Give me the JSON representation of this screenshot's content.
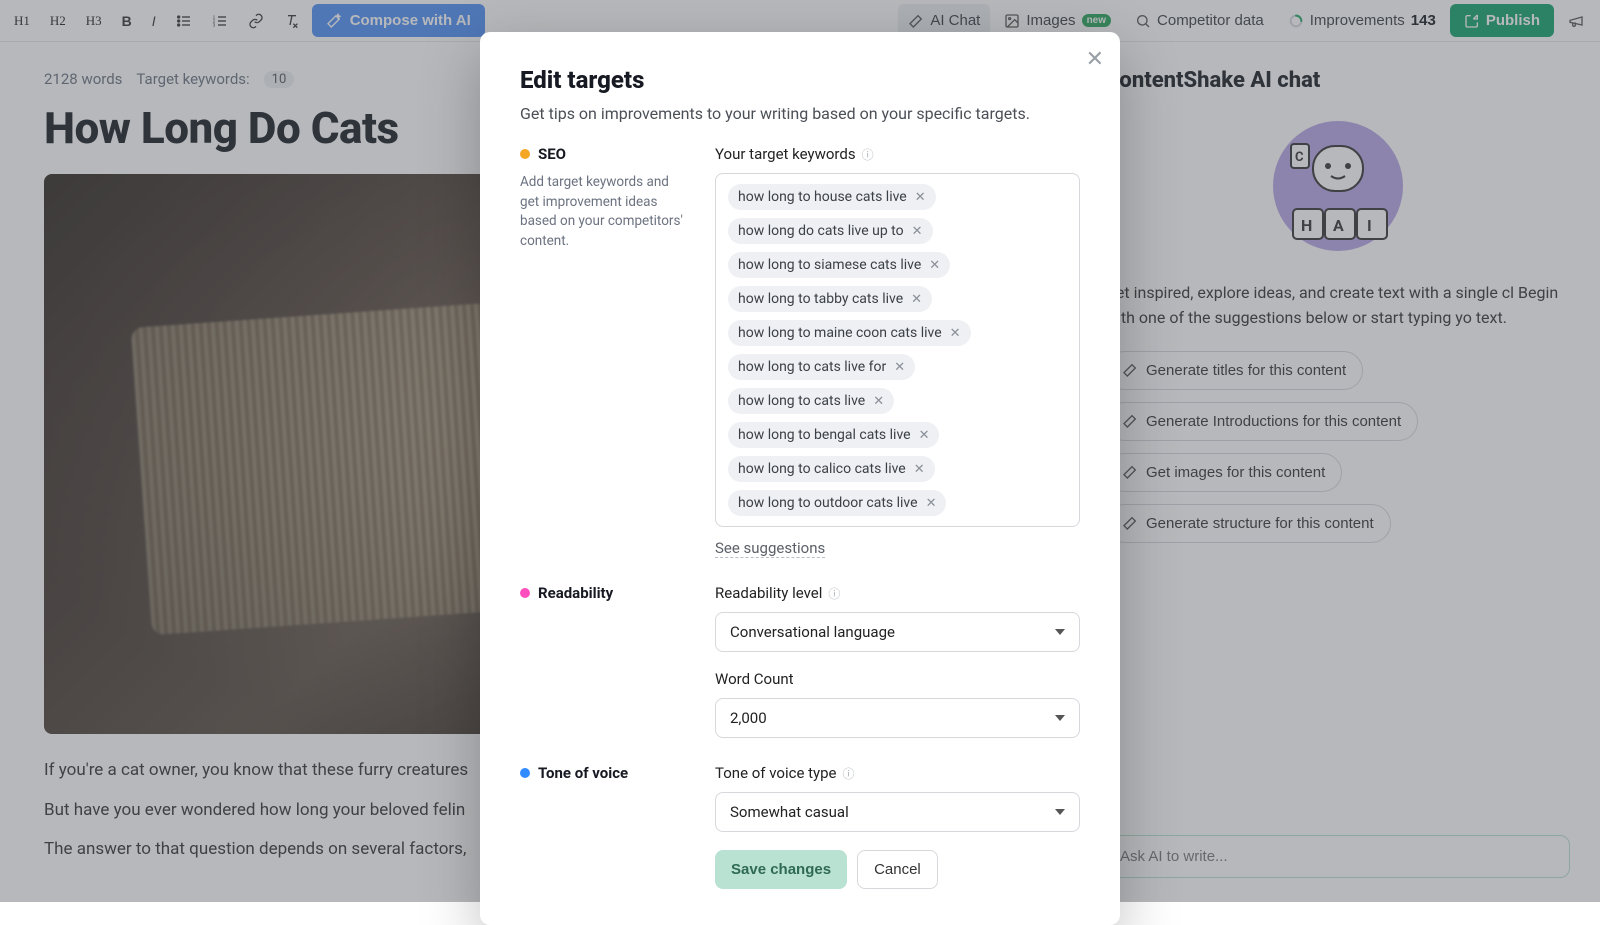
{
  "toolbar": {
    "h1": "H1",
    "h2": "H2",
    "h3": "H3",
    "bold": "B",
    "italic": "I",
    "compose": "Compose with AI",
    "ai_chat": "AI Chat",
    "images": "Images",
    "images_badge": "new",
    "competitor": "Competitor data",
    "improvements": "Improvements",
    "improvements_count": "143",
    "publish": "Publish"
  },
  "meta": {
    "words": "2128 words",
    "target_keywords_label": "Target keywords:",
    "keyword_count": "10"
  },
  "doc": {
    "title": "How Long Do Cats",
    "p1": "If you're a cat owner, you know that these furry creatures",
    "p2": "But have you ever wondered how long your beloved felin",
    "p3": "The answer to that question depends on several factors,"
  },
  "side": {
    "title": "ContentShake AI chat",
    "desc": "Get inspired, explore ideas, and create text with a single cl Begin with one of the suggestions below or start typing yo text.",
    "chips": [
      "Generate titles for this content",
      "Generate Introductions for this content",
      "Get images for this content",
      "Generate structure for this content"
    ],
    "input_placeholder": "Ask AI to write..."
  },
  "modal": {
    "title": "Edit targets",
    "subtitle": "Get tips on improvements to your writing based on your specific targets.",
    "seo_label": "SEO",
    "seo_desc": "Add target keywords and get improvement ideas based on your competitors' content.",
    "keywords_label": "Your target keywords",
    "keywords": [
      "how long to house cats live",
      "how long do cats live up to",
      "how long to siamese cats live",
      "how long to tabby cats live",
      "how long to maine coon cats live",
      "how long to cats live for",
      "how long to cats live",
      "how long to bengal cats live",
      "how long to calico cats live",
      "how long to outdoor cats live"
    ],
    "see_suggestions": "See suggestions",
    "readability_label": "Readability",
    "readability_level_label": "Readability level",
    "readability_value": "Conversational language",
    "wordcount_label": "Word Count",
    "wordcount_value": "2,000",
    "tone_label": "Tone of voice",
    "tone_type_label": "Tone of voice type",
    "tone_value": "Somewhat casual",
    "save": "Save changes",
    "cancel": "Cancel"
  }
}
